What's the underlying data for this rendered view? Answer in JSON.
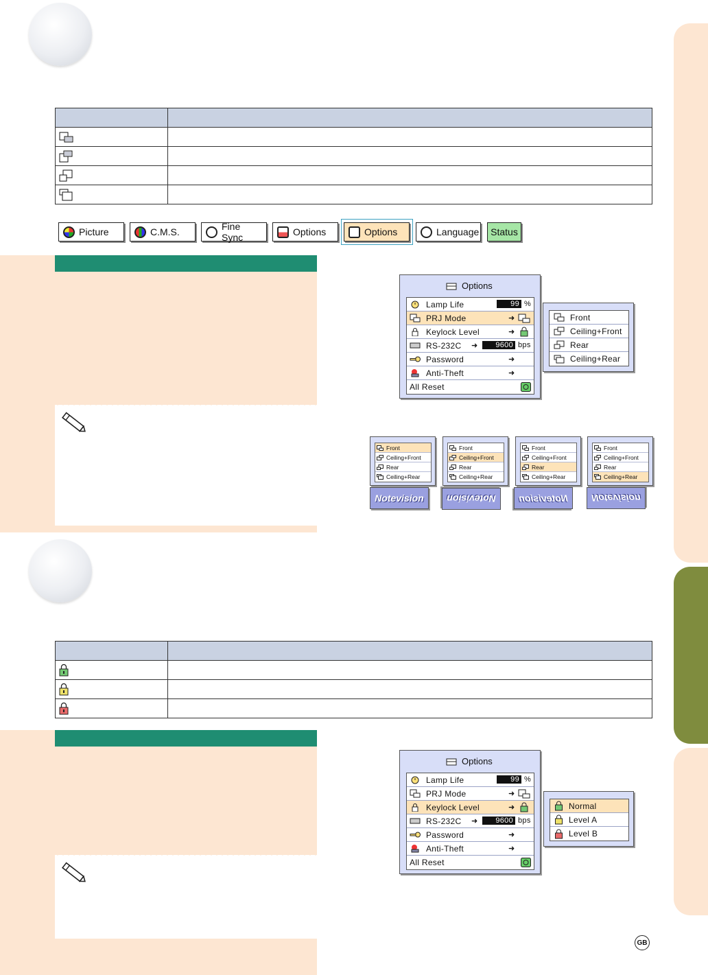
{
  "top_tab_bar": {
    "tabs": [
      {
        "label": "Picture",
        "icon": "picture-icon"
      },
      {
        "label": "C.M.S.",
        "icon": "cms-icon"
      },
      {
        "label": "Fine Sync",
        "icon": "fine-sync-icon"
      },
      {
        "label": "Options",
        "icon": "options1-icon"
      },
      {
        "label": "Options",
        "icon": "options2-icon",
        "selected": true
      },
      {
        "label": "Language",
        "icon": "language-icon"
      },
      {
        "label": "Status",
        "icon": ""
      }
    ]
  },
  "options_menu": {
    "title": "Options",
    "lamp_life_label": "Lamp Life",
    "lamp_life_value": "99",
    "lamp_life_unit": "%",
    "prj_mode_label": "PRJ Mode",
    "keylock_label": "Keylock Level",
    "rs232c_label": "RS-232C",
    "rs232c_value": "9600",
    "rs232c_unit": "bps",
    "password_label": "Password",
    "anti_theft_label": "Anti-Theft",
    "all_reset_label": "All Reset"
  },
  "prj_submenu": [
    "Front",
    "Ceiling+Front",
    "Rear",
    "Ceiling+Rear"
  ],
  "prj_examples": {
    "items": [
      "Front",
      "Ceiling+Front",
      "Rear",
      "Ceiling+Rear"
    ],
    "logo_text": "Notevision"
  },
  "keylock_submenu": [
    "Normal",
    "Level A",
    "Level B"
  ],
  "footer": {
    "region_badge": "GB"
  },
  "colors": {
    "green_bar": "#1f8d72",
    "beige_panel": "#fde6d2",
    "table_header": "#c9d2e2",
    "menu_bg": "#d8def8",
    "highlight": "#fde3b9",
    "edge_tab_olive": "#7f8c3e"
  }
}
